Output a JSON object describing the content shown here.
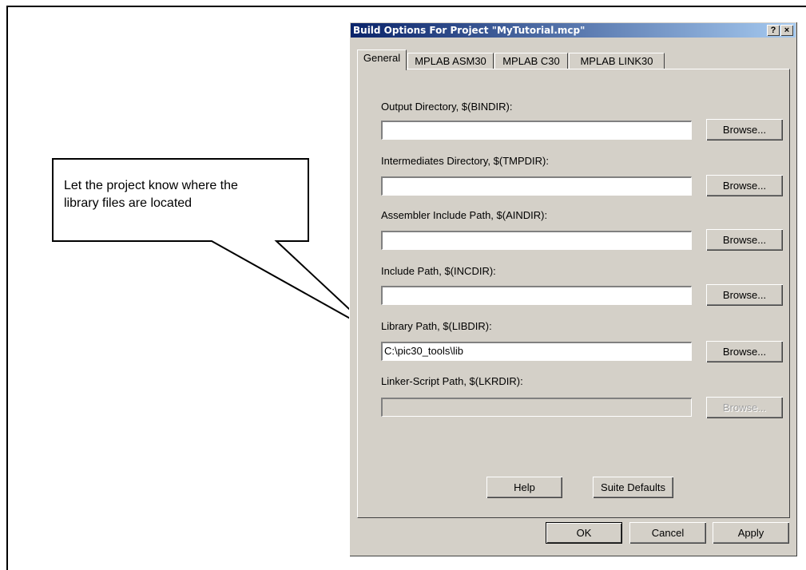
{
  "callout": {
    "text_line1": "Let the project know where the",
    "text_line2": "library files are located"
  },
  "dialog": {
    "title": "Build Options For Project \"MyTutorial.mcp\"",
    "help_icon": "?",
    "close_icon": "×",
    "tabs": [
      {
        "label": "General",
        "active": true
      },
      {
        "label": "MPLAB ASM30",
        "active": false
      },
      {
        "label": "MPLAB C30",
        "active": false
      },
      {
        "label": "MPLAB LINK30",
        "active": false
      }
    ],
    "fields": [
      {
        "label": "Output Directory, $(BINDIR):",
        "value": "",
        "browse_label": "Browse...",
        "enabled": true
      },
      {
        "label": "Intermediates Directory, $(TMPDIR):",
        "value": "",
        "browse_label": "Browse...",
        "enabled": true
      },
      {
        "label": "Assembler Include Path, $(AINDIR):",
        "value": "",
        "browse_label": "Browse...",
        "enabled": true
      },
      {
        "label": "Include Path, $(INCDIR):",
        "value": "",
        "browse_label": "Browse...",
        "enabled": true
      },
      {
        "label": "Library Path, $(LIBDIR):",
        "value": "C:\\pic30_tools\\lib",
        "browse_label": "Browse...",
        "enabled": true
      },
      {
        "label": "Linker-Script Path, $(LKRDIR):",
        "value": "",
        "browse_label": "Browse...",
        "enabled": false
      }
    ],
    "help_label": "Help",
    "suite_defaults_label": "Suite Defaults",
    "ok_label": "OK",
    "cancel_label": "Cancel",
    "apply_label": "Apply"
  },
  "colors": {
    "titlebar_start": "#0a246a",
    "titlebar_end": "#a6caf0",
    "dialog_face": "#d4d0c8"
  }
}
